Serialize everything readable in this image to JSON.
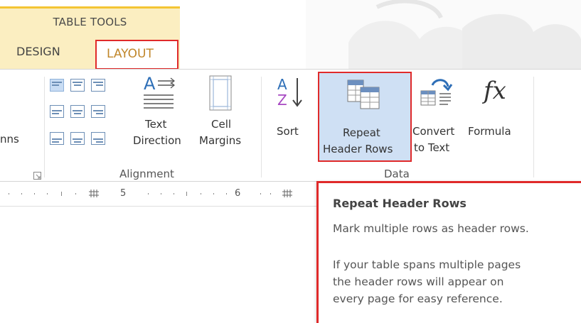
{
  "contextual_tab_group": "TABLE TOOLS",
  "tabs": {
    "design": "DESIGN",
    "layout": "LAYOUT"
  },
  "ribbon": {
    "partial_left_label": "nns",
    "text_direction": {
      "line1": "Text",
      "line2": "Direction"
    },
    "cell_margins": {
      "line1": "Cell",
      "line2": "Margins"
    },
    "alignment_group": "Alignment",
    "sort": "Sort",
    "repeat_header_rows": {
      "line1": "Repeat",
      "line2": "Header Rows"
    },
    "convert_to_text": {
      "line1": "Convert",
      "line2": "to Text"
    },
    "formula": "Formula",
    "formula_icon_text": "fx",
    "data_group": "Data"
  },
  "ruler": {
    "mark_5": "5",
    "mark_6": "6"
  },
  "tooltip": {
    "title": "Repeat Header Rows",
    "line1": "Mark multiple rows as header rows.",
    "body": "If your table spans multiple pages\nthe header rows will appear on\nevery page for easy reference."
  },
  "colors": {
    "highlight_border": "#e02a2a",
    "contextual_tab": "#fbeec1",
    "layout_tab_text": "#c0862a",
    "selected_button": "#cfe0f4"
  }
}
